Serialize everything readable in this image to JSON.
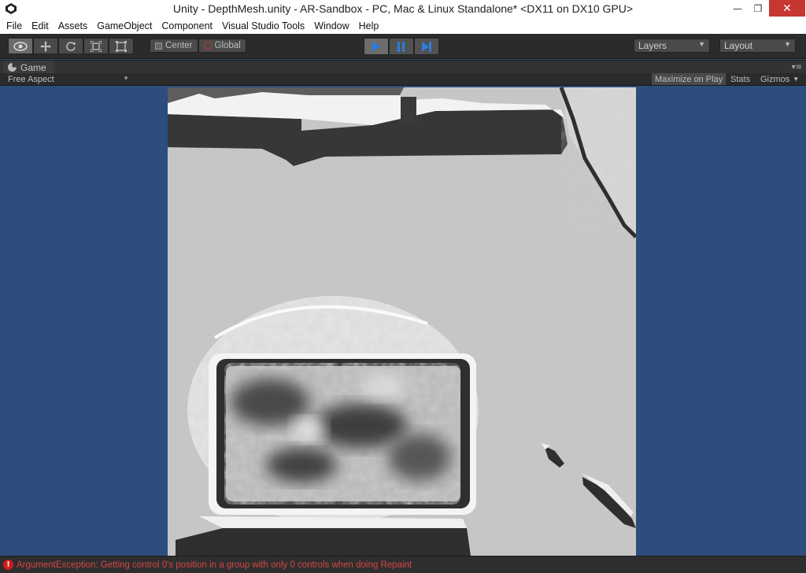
{
  "window": {
    "title": "Unity - DepthMesh.unity - AR-Sandbox - PC, Mac & Linux Standalone* <DX11 on DX10 GPU>",
    "minimize_glyph": "—",
    "maximize_glyph": "❐",
    "close_glyph": "✕"
  },
  "menu": [
    "File",
    "Edit",
    "Assets",
    "GameObject",
    "Component",
    "Visual Studio Tools",
    "Window",
    "Help"
  ],
  "toolbar": {
    "tools": [
      "eye-icon",
      "move-icon",
      "rotate-icon",
      "scale-icon",
      "rect-icon"
    ],
    "pivot_center": "Center",
    "pivot_global": "Global",
    "play": [
      "play-icon",
      "pause-icon",
      "step-icon"
    ],
    "layers": "Layers",
    "layout": "Layout"
  },
  "game_view": {
    "tab_label": "Game",
    "aspect": "Free Aspect",
    "maximize_on_play": "Maximize on Play",
    "stats": "Stats",
    "gizmos": "Gizmos"
  },
  "colors": {
    "background": "#2d4d7c",
    "error": "#d64545"
  },
  "status": {
    "message": "ArgumentException: Getting control 0's position in a group with only 0 controls when doing Repaint"
  }
}
